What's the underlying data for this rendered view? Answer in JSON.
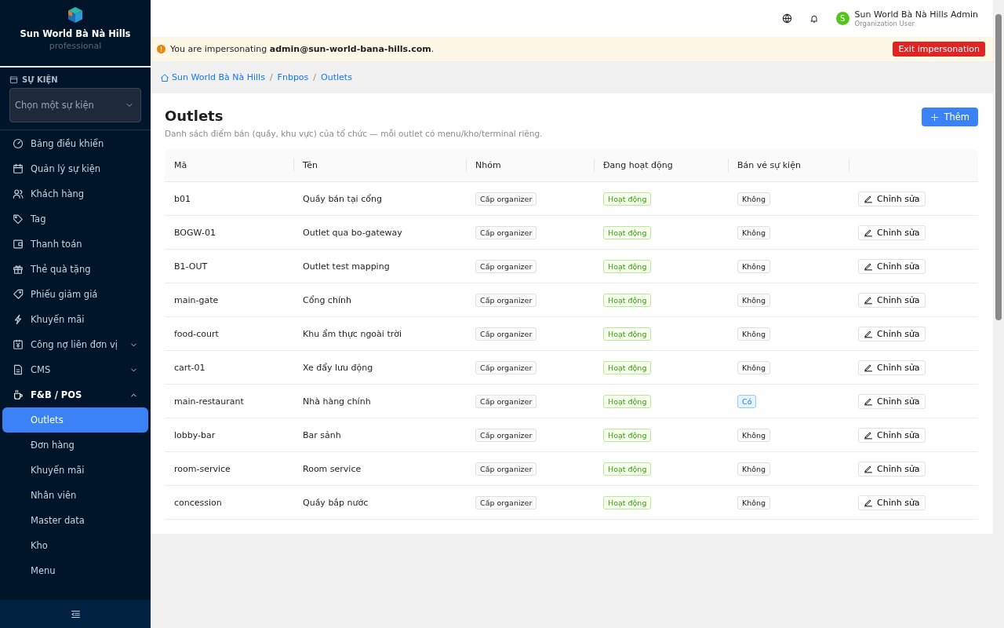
{
  "brand": {
    "name": "Sun World Bà Nà Hills",
    "plan": "professional"
  },
  "event_selector": {
    "label": "SỰ KIỆN",
    "placeholder": "Chọn một sự kiện"
  },
  "sidebar": {
    "items": [
      {
        "label": "Bảng điều khiển"
      },
      {
        "label": "Quản lý sự kiện"
      },
      {
        "label": "Khách hàng"
      },
      {
        "label": "Tag"
      },
      {
        "label": "Thanh toán"
      },
      {
        "label": "Thẻ quà tặng"
      },
      {
        "label": "Phiếu giảm giá"
      },
      {
        "label": "Khuyến mãi"
      },
      {
        "label": "Công nợ liên đơn vị",
        "expanded": false
      },
      {
        "label": "CMS",
        "expanded": false
      },
      {
        "label": "F&B / POS",
        "expanded": true,
        "children": [
          {
            "label": "Outlets",
            "selected": true
          },
          {
            "label": "Đơn hàng",
            "selected": false
          },
          {
            "label": "Khuyến mãi",
            "selected": false
          },
          {
            "label": "Nhân viên",
            "selected": false
          },
          {
            "label": "Master data",
            "selected": false
          },
          {
            "label": "Kho",
            "selected": false
          },
          {
            "label": "Menu",
            "selected": false
          }
        ]
      }
    ]
  },
  "user": {
    "initial": "S",
    "name": "Sun World Bà Nà Hills Admin",
    "role": "Organization User"
  },
  "banner": {
    "text": "You are impersonating **admin@sun-world-bana-hills.com**.",
    "button": "Exit impersonation"
  },
  "breadcrumb": [
    {
      "label": "Sun World Bà Nà Hills"
    },
    {
      "separator": "/",
      "label": "Fnbpos"
    },
    {
      "separator": "/",
      "label": "Outlets"
    }
  ],
  "page": {
    "title": "Outlets",
    "subtitle": "Danh sách điểm bán (quầy, khu vực) của tổ chức — mỗi outlet có menu/kho/terminal riêng.",
    "add_button": "Thêm"
  },
  "table": {
    "columns": [
      "Mã",
      "Tên",
      "Nhóm",
      "Đang hoạt động",
      "Bán vé sự kiện"
    ],
    "rows": [
      {
        "code": "b01",
        "name": "Quầy bán tại cổng",
        "group": "Cấp organizer",
        "status": "Hoạt động",
        "active": true,
        "ticketing": "Không",
        "sells_tickets": false,
        "action": "Chỉnh sửa"
      },
      {
        "code": "BOGW-01",
        "name": "Outlet qua bo-gateway",
        "group": "Cấp organizer",
        "status": "Hoạt động",
        "active": true,
        "ticketing": "Không",
        "sells_tickets": false,
        "action": "Chỉnh sửa"
      },
      {
        "code": "B1-OUT",
        "name": "Outlet test mapping",
        "group": "Cấp organizer",
        "status": "Hoạt động",
        "active": true,
        "ticketing": "Không",
        "sells_tickets": false,
        "action": "Chỉnh sửa"
      },
      {
        "code": "main-gate",
        "name": "Cổng chính",
        "group": "Cấp organizer",
        "status": "Hoạt động",
        "active": true,
        "ticketing": "Không",
        "sells_tickets": false,
        "action": "Chỉnh sửa"
      },
      {
        "code": "food-court",
        "name": "Khu ẩm thực ngoài trời",
        "group": "Cấp organizer",
        "status": "Hoạt động",
        "active": true,
        "ticketing": "Không",
        "sells_tickets": false,
        "action": "Chỉnh sửa"
      },
      {
        "code": "cart-01",
        "name": "Xe đẩy lưu động",
        "group": "Cấp organizer",
        "status": "Hoạt động",
        "active": true,
        "ticketing": "Không",
        "sells_tickets": false,
        "action": "Chỉnh sửa"
      },
      {
        "code": "main-restaurant",
        "name": "Nhà hàng chính",
        "group": "Cấp organizer",
        "status": "Hoạt động",
        "active": true,
        "ticketing": "Có",
        "sells_tickets": true,
        "action": "Chỉnh sửa"
      },
      {
        "code": "lobby-bar",
        "name": "Bar sảnh",
        "group": "Cấp organizer",
        "status": "Hoạt động",
        "active": true,
        "ticketing": "Không",
        "sells_tickets": false,
        "action": "Chỉnh sửa"
      },
      {
        "code": "room-service",
        "name": "Room service",
        "group": "Cấp organizer",
        "status": "Hoạt động",
        "active": true,
        "ticketing": "Không",
        "sells_tickets": false,
        "action": "Chỉnh sửa"
      },
      {
        "code": "concession",
        "name": "Quầy bắp nước",
        "group": "Cấp organizer",
        "status": "Hoạt động",
        "active": true,
        "ticketing": "Không",
        "sells_tickets": false,
        "action": "Chỉnh sửa"
      }
    ]
  }
}
